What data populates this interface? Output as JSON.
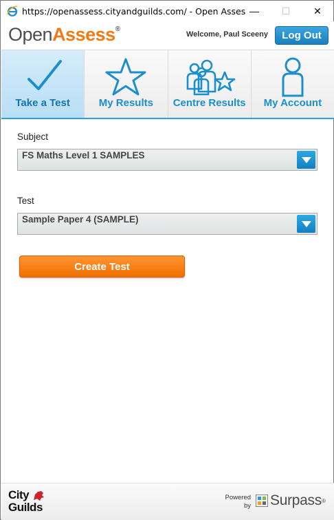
{
  "window": {
    "title": "https://openassess.cityandguilds.com/ - Open Assess - Ce...",
    "minimize_glyph": "—",
    "maximize_glyph": "☐",
    "close_glyph": "✕"
  },
  "header": {
    "logo_open": "Open",
    "logo_assess": "Assess",
    "logo_reg": "®",
    "welcome": "Welcome,  Paul Sceeny",
    "logout_label": "Log Out"
  },
  "nav": {
    "tabs": [
      {
        "label": "Take a Test",
        "icon": "checkmark-icon",
        "active": true
      },
      {
        "label": "My Results",
        "icon": "star-icon",
        "active": false
      },
      {
        "label": "Centre Results",
        "icon": "group-stars-icon",
        "active": false
      },
      {
        "label": "My Account",
        "icon": "person-icon",
        "active": false
      }
    ]
  },
  "form": {
    "subject_label": "Subject",
    "subject_value": "FS Maths Level 1 SAMPLES",
    "test_label": "Test",
    "test_value": "Sample Paper 4 (SAMPLE)",
    "create_label": "Create Test"
  },
  "footer": {
    "cg_line1": "City",
    "cg_line2": "Guilds",
    "powered_line1": "Powered",
    "powered_line2": "by",
    "surpass": "Surpass",
    "surpass_tm": "®"
  },
  "colors": {
    "brand_orange": "#f07b16",
    "brand_blue": "#1b8fcc",
    "logout_blue": "#1a7fbf",
    "create_orange": "#f26f00"
  }
}
